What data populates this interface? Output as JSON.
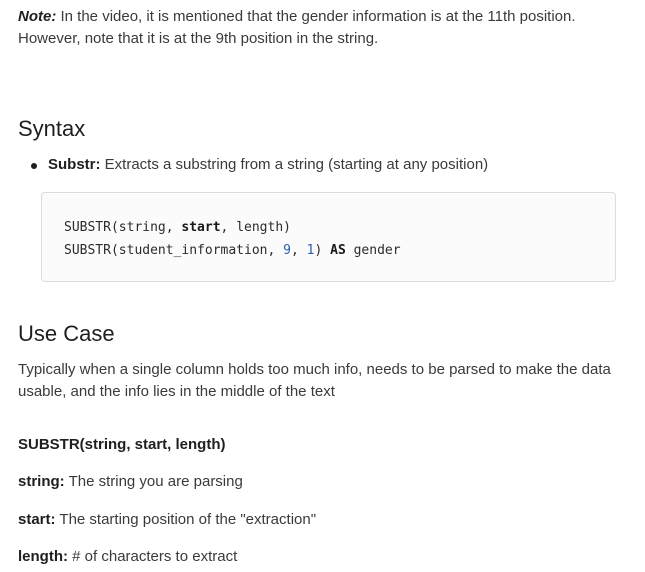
{
  "note": {
    "label": "Note:",
    "text": " In the video, it is mentioned that the gender information is at the 11th position. However, note that it is at the 9th position in the string."
  },
  "syntax": {
    "heading": "Syntax",
    "bullets": [
      {
        "term": "Substr:",
        "desc": " Extracts a substring from a string (starting at any position)"
      }
    ],
    "code": {
      "line1": {
        "fn": "SUBSTR(string, ",
        "kw": "start",
        "rest": ", length)"
      },
      "line2": {
        "fn": "SUBSTR(student_information, ",
        "n1": "9",
        "sep": ", ",
        "n2": "1",
        "close": ") ",
        "kw": "AS",
        "rest": " gender"
      }
    }
  },
  "use_case": {
    "heading": "Use Case",
    "text": "Typically when a single column holds too much info, needs to be parsed to make the data usable, and the info lies in the middle of the text",
    "signature": "SUBSTR(string, start, length)",
    "params": [
      {
        "term": "string:",
        "desc": " The string you are parsing"
      },
      {
        "term": "start:",
        "desc": " The starting position of the \"extraction\""
      },
      {
        "term": "length:",
        "desc": " # of characters to extract"
      }
    ]
  }
}
